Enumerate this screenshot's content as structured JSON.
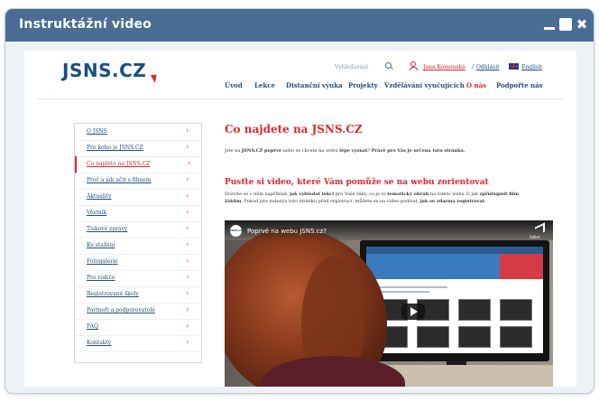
{
  "window": {
    "title": "Instruktážní video",
    "controls": [
      "minimize-icon",
      "maximize-icon",
      "close-icon"
    ],
    "close_glyph": "✖"
  },
  "site": {
    "logo": "JSNS.CZ",
    "top_links": {
      "search": "Vyhledávání",
      "user": "Jana Komenská",
      "separator": "/",
      "logout": "Odhlásit",
      "language": "English"
    },
    "nav": [
      "Úvod",
      "Lekce",
      "Distanční výuka",
      "Projekty",
      "Vzdělávání vyučujících",
      "O nás",
      "Podpořte nás"
    ],
    "nav_active": "O nás"
  },
  "sidebar": {
    "items": [
      "O JSNS",
      "Pro koho je JSNS.CZ",
      "Co najdete na JSNS.CZ",
      "Proč a jak učit s filmem",
      "Aktuality",
      "Věstník",
      "Tiskové zprávy",
      "Ke stažení",
      "Fotogalerie",
      "Pro rodiče",
      "Registrované školy",
      "Partneři a podporovatelé",
      "FAQ",
      "Kontakty"
    ],
    "active": "Co najdete na JSNS.CZ",
    "chevron": "›"
  },
  "content": {
    "title": "Co najdete na JSNS.CZ",
    "intro": {
      "p1": "Jste na ",
      "b1": "JSNS.CZ poprvé",
      "p2": " nebo se chcete na webu ",
      "b2": "lépe vyznat",
      "p3": "? ",
      "b3": "Právě pro Vás je určena tato stránka."
    },
    "video_heading": "Pusťte si video, které Vám pomůže se na webu zorientovat",
    "desc": {
      "l1_a": "Dozvíte se v něm například, ",
      "l1_b": "jak vyhledat lekci",
      "l1_c": " pro Vaše žáky, co je to ",
      "l1_d": "tematický okruh",
      "l1_e": " na tomto webu či jak ",
      "l1_f": "zpřístupnit film",
      "l2_a": "žákům",
      "l2_b": ". Pokud jste nalezi/a tuto stránku před registrací, můžete se na video podívat, ",
      "l2_c": "jak se zdarma registrovat",
      "l2_d": "."
    }
  },
  "video": {
    "channel": "JSNS.CZ",
    "title": "Poprvé na webu JSNS.cz?",
    "share_label": "Sdílet",
    "brand": "JSNS"
  },
  "colors": {
    "titlebar": "#4a6d94",
    "brand_blue": "#1b4e83",
    "accent_red": "#e0262e"
  }
}
